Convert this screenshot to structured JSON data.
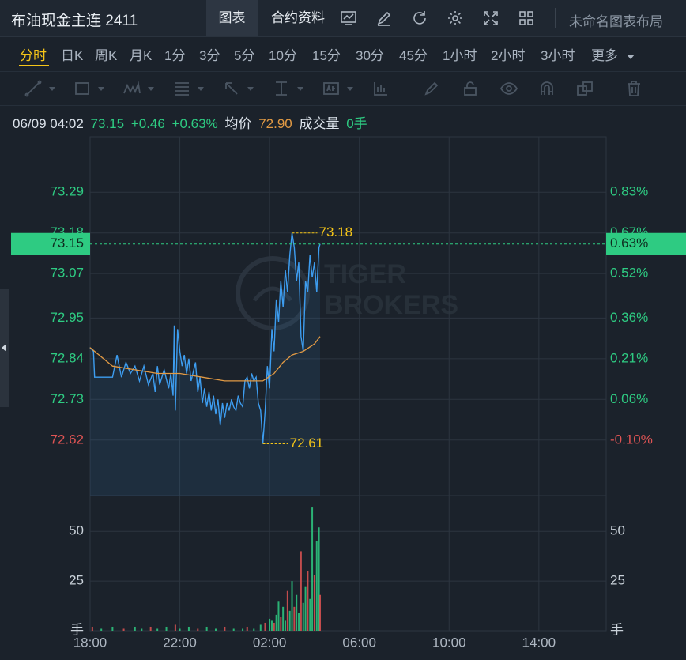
{
  "header": {
    "title": "布油现金主连 2411",
    "tabs": [
      {
        "label": "图表",
        "active": true
      },
      {
        "label": "合约资料",
        "active": false
      }
    ],
    "icons": [
      "chart-template-icon",
      "draw-pen-icon",
      "refresh-icon",
      "settings-gear-icon",
      "fullscreen-icon",
      "grid-layout-icon"
    ],
    "layout_label": "未命名图表布局"
  },
  "periods": {
    "items": [
      "分时",
      "日K",
      "周K",
      "月K",
      "1分",
      "3分",
      "5分",
      "10分",
      "15分",
      "30分",
      "45分",
      "1小时",
      "2小时",
      "3小时",
      "更多"
    ],
    "active": "分时"
  },
  "drawing_tools": [
    "trend-line-icon",
    "rectangle-icon",
    "pattern-icon",
    "fib-icon",
    "arrow-icon",
    "measure-icon",
    "text-note-icon",
    "bars-icon",
    "pencil-icon",
    "lock-icon",
    "eye-icon",
    "magnet-icon",
    "duplicate-icon",
    "trash-icon"
  ],
  "quote": {
    "datetime": "06/09 04:02",
    "price": "73.15",
    "change": "+0.46",
    "change_pct": "+0.63%",
    "avg_label": "均价",
    "avg_value": "72.90",
    "volume_label": "成交量",
    "volume_value": "0手"
  },
  "colors": {
    "up": "#2ecb82",
    "down": "#e05454",
    "price_line": "#3d9df0",
    "avg_line": "#e29a44",
    "marker": "#f5c518"
  },
  "chart_data": {
    "type": "line",
    "xticks": [
      "18:00",
      "22:00",
      "02:00",
      "06:00",
      "10:00",
      "14:00"
    ],
    "x_range_hours": [
      0,
      23
    ],
    "price_axis": {
      "ticks": [
        73.29,
        73.18,
        73.07,
        72.95,
        72.84,
        72.73,
        72.62
      ],
      "pct_ticks": [
        "0.83%",
        "0.67%",
        "0.52%",
        "0.36%",
        "0.21%",
        "0.06%",
        "-0.10%"
      ],
      "ylim": [
        72.47,
        73.44
      ],
      "base": 72.69
    },
    "current_price": {
      "value": 73.15,
      "label": "73.15",
      "pct_label": "0.63%"
    },
    "high_marker": {
      "value": 73.18,
      "label": "73.18",
      "x_hours": 9.0
    },
    "low_marker": {
      "value": 72.61,
      "label": "72.61",
      "x_hours": 7.7
    },
    "price_series": [
      [
        0.0,
        72.87
      ],
      [
        0.15,
        72.86
      ],
      [
        0.2,
        72.79
      ],
      [
        0.5,
        72.79
      ],
      [
        1.0,
        72.79
      ],
      [
        1.2,
        72.85
      ],
      [
        1.4,
        72.79
      ],
      [
        1.6,
        72.83
      ],
      [
        1.8,
        72.8
      ],
      [
        2.0,
        72.82
      ],
      [
        2.2,
        72.78
      ],
      [
        2.4,
        72.82
      ],
      [
        2.6,
        72.77
      ],
      [
        2.8,
        72.8
      ],
      [
        2.9,
        72.75
      ],
      [
        3.0,
        72.82
      ],
      [
        3.1,
        72.77
      ],
      [
        3.3,
        72.81
      ],
      [
        3.5,
        72.76
      ],
      [
        3.6,
        72.8
      ],
      [
        3.7,
        72.74
      ],
      [
        3.75,
        72.93
      ],
      [
        3.8,
        72.7
      ],
      [
        3.9,
        72.92
      ],
      [
        4.0,
        72.86
      ],
      [
        4.1,
        72.82
      ],
      [
        4.2,
        72.85
      ],
      [
        4.3,
        72.8
      ],
      [
        4.4,
        72.84
      ],
      [
        4.5,
        72.78
      ],
      [
        4.7,
        72.83
      ],
      [
        4.8,
        72.75
      ],
      [
        4.9,
        72.79
      ],
      [
        5.0,
        72.72
      ],
      [
        5.1,
        72.76
      ],
      [
        5.2,
        72.71
      ],
      [
        5.3,
        72.75
      ],
      [
        5.4,
        72.7
      ],
      [
        5.5,
        72.74
      ],
      [
        5.6,
        72.69
      ],
      [
        5.7,
        72.73
      ],
      [
        5.8,
        72.66
      ],
      [
        5.9,
        72.72
      ],
      [
        6.0,
        72.68
      ],
      [
        6.1,
        72.72
      ],
      [
        6.2,
        72.7
      ],
      [
        6.3,
        72.73
      ],
      [
        6.4,
        72.71
      ],
      [
        6.5,
        72.7
      ],
      [
        6.6,
        72.74
      ],
      [
        6.7,
        72.72
      ],
      [
        6.8,
        72.71
      ],
      [
        6.9,
        72.78
      ],
      [
        7.0,
        72.79
      ],
      [
        7.1,
        72.76
      ],
      [
        7.2,
        72.8
      ],
      [
        7.3,
        72.78
      ],
      [
        7.4,
        72.79
      ],
      [
        7.5,
        72.72
      ],
      [
        7.6,
        72.7
      ],
      [
        7.7,
        72.61
      ],
      [
        7.8,
        72.7
      ],
      [
        7.9,
        72.82
      ],
      [
        8.0,
        72.76
      ],
      [
        8.1,
        72.92
      ],
      [
        8.2,
        72.86
      ],
      [
        8.3,
        73.0
      ],
      [
        8.4,
        72.94
      ],
      [
        8.5,
        73.05
      ],
      [
        8.6,
        72.98
      ],
      [
        8.7,
        73.08
      ],
      [
        8.8,
        73.02
      ],
      [
        8.9,
        73.12
      ],
      [
        9.0,
        73.18
      ],
      [
        9.1,
        73.14
      ],
      [
        9.2,
        73.05
      ],
      [
        9.3,
        73.1
      ],
      [
        9.4,
        72.9
      ],
      [
        9.5,
        72.86
      ],
      [
        9.6,
        73.05
      ],
      [
        9.7,
        73.02
      ],
      [
        9.8,
        73.12
      ],
      [
        9.9,
        73.06
      ],
      [
        10.0,
        73.1
      ],
      [
        10.1,
        73.02
      ],
      [
        10.2,
        73.14
      ],
      [
        10.25,
        73.15
      ]
    ],
    "avg_series": [
      [
        0.0,
        72.87
      ],
      [
        1.0,
        72.82
      ],
      [
        2.0,
        72.81
      ],
      [
        3.0,
        72.8
      ],
      [
        4.0,
        72.8
      ],
      [
        5.0,
        72.79
      ],
      [
        6.0,
        72.78
      ],
      [
        7.0,
        72.78
      ],
      [
        7.7,
        72.78
      ],
      [
        8.2,
        72.8
      ],
      [
        8.6,
        72.83
      ],
      [
        9.0,
        72.85
      ],
      [
        9.5,
        72.86
      ],
      [
        10.0,
        72.88
      ],
      [
        10.25,
        72.9
      ]
    ],
    "volume_axis": {
      "ticks": [
        50,
        25
      ],
      "unit_label": "手",
      "ylim": [
        0,
        68
      ]
    },
    "volume_series": [
      [
        0.1,
        2
      ],
      [
        0.5,
        1
      ],
      [
        1.0,
        2
      ],
      [
        1.5,
        1
      ],
      [
        2.0,
        2
      ],
      [
        2.3,
        1
      ],
      [
        2.7,
        2
      ],
      [
        3.0,
        1
      ],
      [
        3.4,
        2
      ],
      [
        3.8,
        3
      ],
      [
        4.0,
        1
      ],
      [
        4.4,
        2
      ],
      [
        4.8,
        1
      ],
      [
        5.2,
        2
      ],
      [
        5.6,
        1
      ],
      [
        6.0,
        2
      ],
      [
        6.4,
        1
      ],
      [
        6.8,
        1
      ],
      [
        7.0,
        2
      ],
      [
        7.3,
        1
      ],
      [
        7.6,
        3
      ],
      [
        7.8,
        4
      ],
      [
        8.0,
        6
      ],
      [
        8.1,
        5
      ],
      [
        8.2,
        4
      ],
      [
        8.3,
        8
      ],
      [
        8.4,
        15
      ],
      [
        8.5,
        7
      ],
      [
        8.6,
        12
      ],
      [
        8.7,
        5
      ],
      [
        8.8,
        20
      ],
      [
        8.9,
        10
      ],
      [
        9.0,
        25
      ],
      [
        9.1,
        12
      ],
      [
        9.2,
        18
      ],
      [
        9.3,
        9
      ],
      [
        9.4,
        40
      ],
      [
        9.5,
        14
      ],
      [
        9.6,
        22
      ],
      [
        9.7,
        30
      ],
      [
        9.8,
        16
      ],
      [
        9.9,
        62
      ],
      [
        10.0,
        28
      ],
      [
        10.1,
        45
      ],
      [
        10.2,
        52
      ],
      [
        10.25,
        18
      ]
    ]
  }
}
